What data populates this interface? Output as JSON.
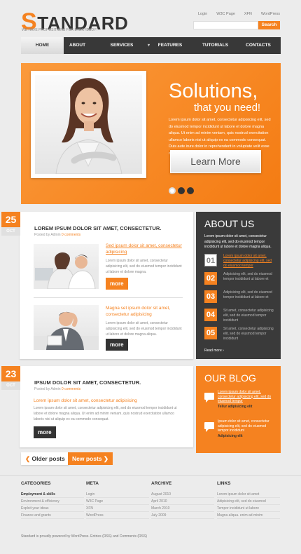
{
  "header": {
    "logo_first": "S",
    "logo_rest": "TANDARD",
    "tagline": "WE HAVE PROPOSITIONS FOR EVERYBODY!",
    "toplinks": [
      "Login",
      "W3C Page",
      "XFN",
      "WordPress"
    ],
    "search_button": "Search"
  },
  "nav": {
    "items": [
      {
        "label": "HOME",
        "active": true
      },
      {
        "label": "ABOUT"
      },
      {
        "label": "SERVICES",
        "has_dropdown": true
      },
      {
        "label": "FEATURES"
      },
      {
        "label": "TUTORIALS"
      },
      {
        "label": "CONTACTS"
      }
    ]
  },
  "hero": {
    "title": "Solutions,",
    "subtitle": "that you need!",
    "text": "Lorem ipsum dolor sit amet, consectetur adipisicing elit, sed do eiusmod tempor incididunt ut labore et dolore magna aliqua. Ut enim ad minim veniam, quis nostrud exercitation ullamco laboris nisi ut aliquip ex ea commodo consequat. Duis aute irure dolor in reprehenderit in voluptate velit esse cillum dolore eu fugiat nulla pariatur.",
    "button": "Learn More",
    "slide_count": 3,
    "active_slide": 1
  },
  "posts": [
    {
      "day": "25",
      "month": "OCT",
      "title": "LOREM IPSUM DOLOR SIT AMET, CONSECTETUR.",
      "meta_prefix": "Posted by Admin",
      "meta_comments": "0 comments",
      "items": [
        {
          "title": "Sed ipsum dolor sit amet, consectetur adipisicing",
          "text": "Lorem ipsum dolor sit amet, consectetur adipisicing elit, sed do eiusmod tempor incididunt ut labore et dolore magna.",
          "button": "more"
        },
        {
          "title": "Magna set ipsum dolor sit amet, consectetur adipisicing",
          "text": "Lorem ipsum dolor sit amet, consectetur adipisicing elit, sed do eiusmod tempor incididunt ut labore et dolore magna aliqua.",
          "button": "more"
        }
      ]
    },
    {
      "day": "23",
      "month": "OCT",
      "title": "IPSUM DOLOR SIT AMET, CONSECTETUR.",
      "meta_prefix": "Posted by Admin",
      "meta_comments": "0 comments",
      "subtitle": "Lorem ipsum dolor sit amet, consectetur adipisicing",
      "text": "Lorem ipsum dolor sit amet, consectetur adipisicing elit, sed do eiusmod tempor incididunt ut labore et dolore magna aliqua. Ut enim ad minim veniam, quis nostrud exercitation ullamco laboris nisi ut aliquip ex ea commodo consequat.",
      "button": "more"
    }
  ],
  "about": {
    "title": "ABOUT US",
    "intro": "Lorem ipsum dolor sit amet, consectetur adipisicing elit, sed do eiusmod tempor incididunt ut labore et dolore magna aliqua.",
    "items": [
      {
        "num": "01",
        "text": "Lorem ipsum dolor sit amet, consectetur adipisicing elit, sed do eiusmod tempor"
      },
      {
        "num": "02",
        "text": "Adipisicing elit, sed do eiusmod tempor incididunt ut labore et"
      },
      {
        "num": "03",
        "text": "Adipisicing elit, sed do eiusmod tempor incididunt ut labore et"
      },
      {
        "num": "04",
        "text": "Sit amet, consectetur adipisicing elit, sed do eiusmod tempor incididunt"
      },
      {
        "num": "05",
        "text": "Sit amet, consectetur adipisicing elit, sed do eiusmod tempor incididunt"
      }
    ],
    "read_more": "Read more ›"
  },
  "blog": {
    "title": "OUR BLOG",
    "items": [
      {
        "text": "Lorem ipsum dolor sit amet, consectetur adipisicing elit, sed do eiusmod tempor",
        "sub": "Tellur adipisicing elit"
      },
      {
        "text": "Ipsum dolor sit amet, consectetur adipisicing elit, sed do eiusmod tempor incididunt",
        "sub": "Adipisicing elit"
      }
    ]
  },
  "pager": {
    "older": "Older posts",
    "newer": "New posts"
  },
  "footer": {
    "columns": [
      {
        "title": "CATEGORIES",
        "items": [
          "Employment & skills",
          "Environment & efficiency",
          "Exploit your ideas",
          "Finance and grants"
        ]
      },
      {
        "title": "META",
        "items": [
          "Login",
          "W3C Page",
          "XFN",
          "WordPress"
        ]
      },
      {
        "title": "ARCHIVE",
        "items": [
          "August 2010",
          "April 2010",
          "March 2010",
          "July 2009"
        ]
      },
      {
        "title": "LINKS",
        "items": [
          "Lorem ipsum dolor sit amet",
          "Adipisicing elit, sed do eiusmod",
          "Tempor incididunt ut labore",
          "Magna aliqua. enim ad minim"
        ]
      }
    ],
    "copyright": "Standard is proudly powered by WordPress. Entries (RSS) and Comments (RSS)"
  },
  "colors": {
    "accent": "#f58220",
    "dark": "#3a3a3a",
    "background": "#ececec"
  }
}
